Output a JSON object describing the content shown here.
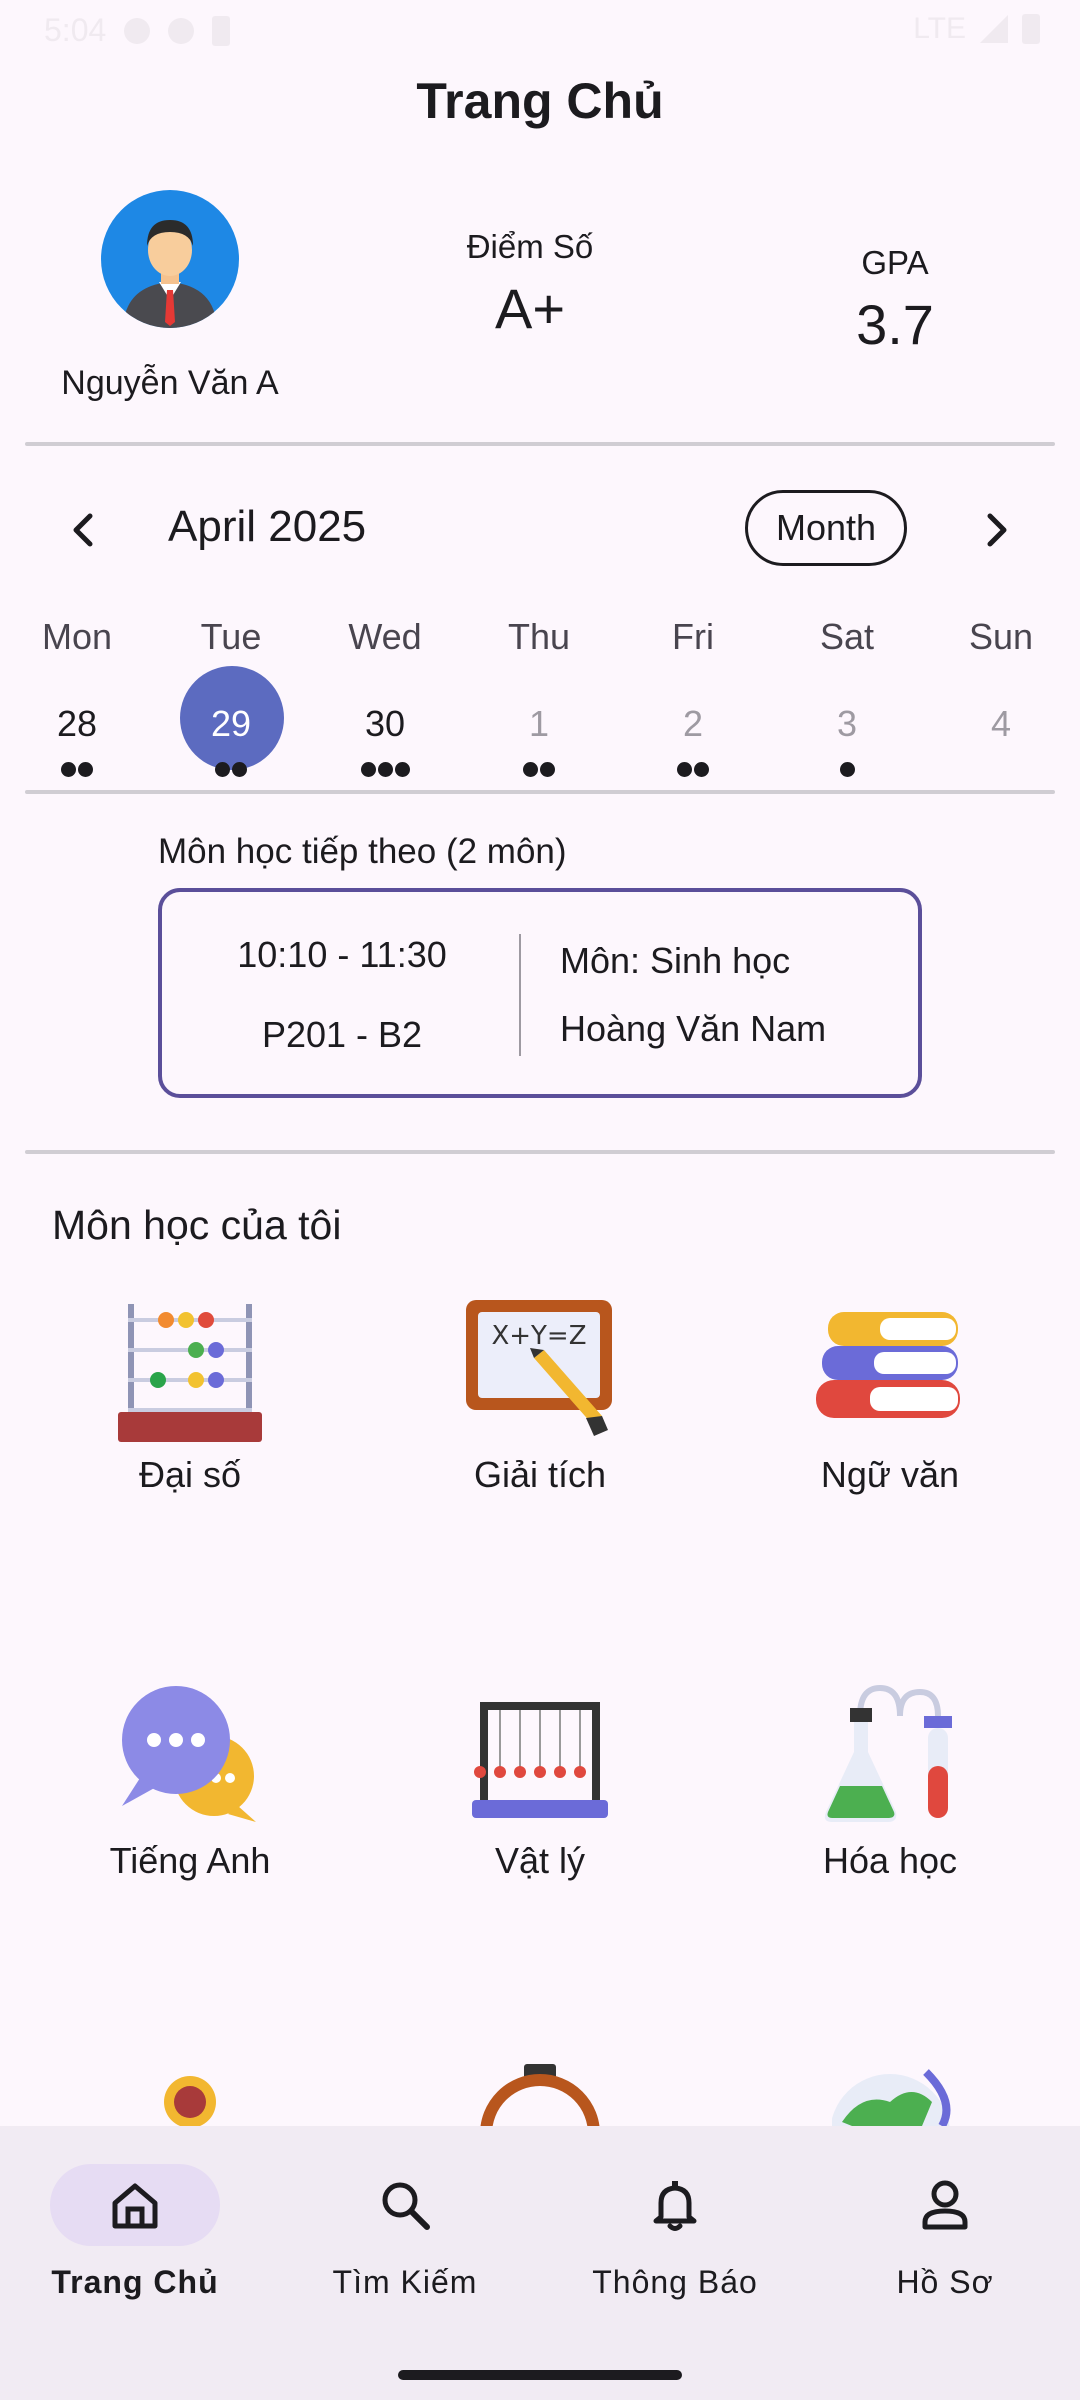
{
  "status_bar": {
    "time": "5:04",
    "network": "LTE"
  },
  "page_title": "Trang Chủ",
  "profile": {
    "name": "Nguyễn Văn A"
  },
  "stats": [
    {
      "label": "Điểm Số",
      "value": "A+"
    },
    {
      "label": "GPA",
      "value": "3.7"
    }
  ],
  "calendar": {
    "month_label": "April 2025",
    "view_button": "Month",
    "weekdays": [
      "Mon",
      "Tue",
      "Wed",
      "Thu",
      "Fri",
      "Sat",
      "Sun"
    ],
    "days": [
      {
        "num": "28",
        "events": 2,
        "muted": false,
        "selected": false
      },
      {
        "num": "29",
        "events": 2,
        "muted": false,
        "selected": true
      },
      {
        "num": "30",
        "events": 3,
        "muted": false,
        "selected": false
      },
      {
        "num": "1",
        "events": 2,
        "muted": true,
        "selected": false
      },
      {
        "num": "2",
        "events": 2,
        "muted": true,
        "selected": false
      },
      {
        "num": "3",
        "events": 1,
        "muted": true,
        "selected": false
      },
      {
        "num": "4",
        "events": 0,
        "muted": true,
        "selected": false
      }
    ]
  },
  "next_class": {
    "title": "Môn học tiếp theo (2 môn)",
    "time": "10:10 - 11:30",
    "room": "P201 - B2",
    "subject": "Môn: Sinh học",
    "teacher": "Hoàng Văn Nam"
  },
  "courses": {
    "title": "Môn học của tôi",
    "items": [
      {
        "label": "Đại số",
        "icon": "abacus-icon"
      },
      {
        "label": "Giải tích",
        "icon": "formula-board-icon"
      },
      {
        "label": "Ngữ văn",
        "icon": "books-icon"
      },
      {
        "label": "Tiếng Anh",
        "icon": "chat-bubbles-icon"
      },
      {
        "label": "Vật lý",
        "icon": "newtons-cradle-icon"
      },
      {
        "label": "Hóa học",
        "icon": "lab-flask-icon"
      }
    ]
  },
  "bottom_nav": {
    "items": [
      {
        "label": "Trang Chủ",
        "icon": "home-icon",
        "active": true
      },
      {
        "label": "Tìm Kiếm",
        "icon": "search-icon",
        "active": false
      },
      {
        "label": "Thông Báo",
        "icon": "bell-icon",
        "active": false
      },
      {
        "label": "Hồ Sơ",
        "icon": "person-icon",
        "active": false
      }
    ]
  }
}
